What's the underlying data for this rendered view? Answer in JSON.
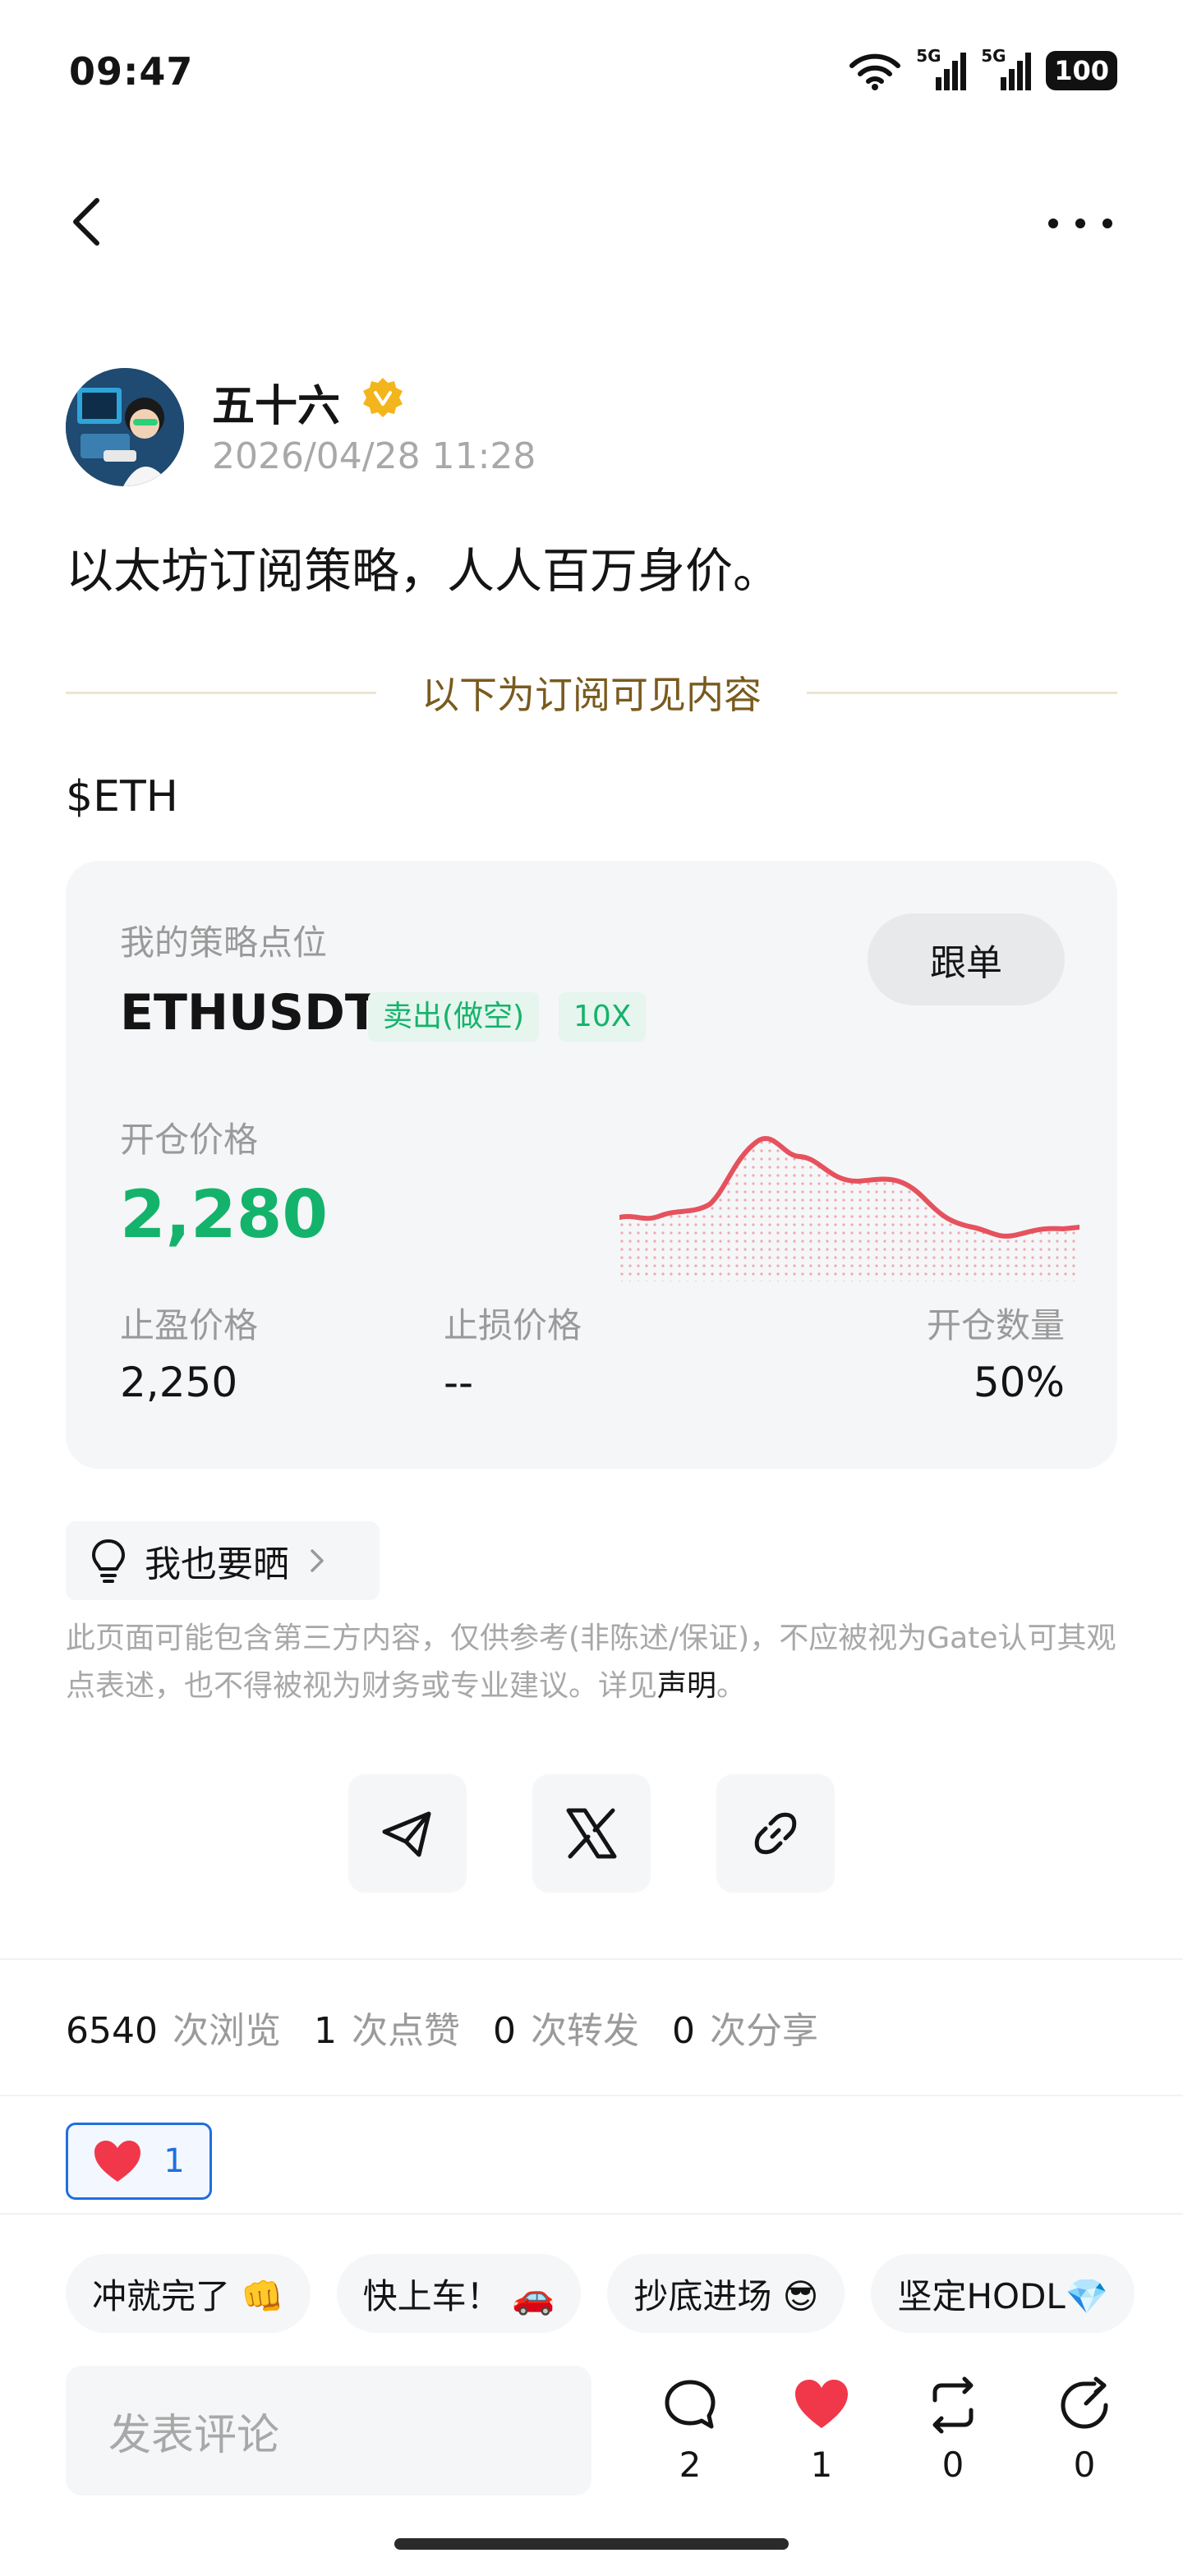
{
  "status": {
    "time": "09:47",
    "signal1": "5G",
    "signal2": "5G",
    "battery": "100"
  },
  "author": {
    "name": "五十六",
    "time": "2026/04/28 11:28"
  },
  "post": {
    "text": "以太坊订阅策略，人人百万身价。",
    "divider": "以下为订阅可见内容",
    "ticker": "$ETH"
  },
  "strategy": {
    "label": "我的策略点位",
    "symbol": "ETHUSDT",
    "side": "卖出(做空)",
    "leverage": "10X",
    "follow_label": "跟单",
    "open_label": "开仓价格",
    "open_price": "2,280",
    "tp_label": "止盈价格",
    "tp_value": "2,250",
    "sl_label": "止损价格",
    "sl_value": "--",
    "size_label": "开仓数量",
    "size_value": "50%",
    "line_color": "#e5525e"
  },
  "share_own": "我也要晒",
  "disclaimer": {
    "text": "此页面可能包含第三方内容，仅供参考(非陈述/保证)，不应被视为Gate认可其观点表述，也不得被视为财务或专业建议。详见",
    "link": "声明",
    "end": "。"
  },
  "stats": {
    "views": "6540",
    "views_label": "次浏览",
    "likes": "1",
    "likes_label": "次点赞",
    "reposts": "0",
    "reposts_label": "次转发",
    "shares": "0",
    "shares_label": "次分享"
  },
  "reaction": {
    "count": "1"
  },
  "quick_replies": [
    "冲就完了 👊",
    "快上车！ 🚗",
    "抄底进场 😎",
    "坚定HODL💎"
  ],
  "comment_placeholder": "发表评论",
  "actions": {
    "comments": "2",
    "likes": "1",
    "reposts": "0",
    "shares": "0"
  },
  "colors": {
    "green": "#14b36b",
    "red": "#e5525e",
    "accent_blue": "#1e6fe0",
    "gold": "#7a5a1e"
  }
}
